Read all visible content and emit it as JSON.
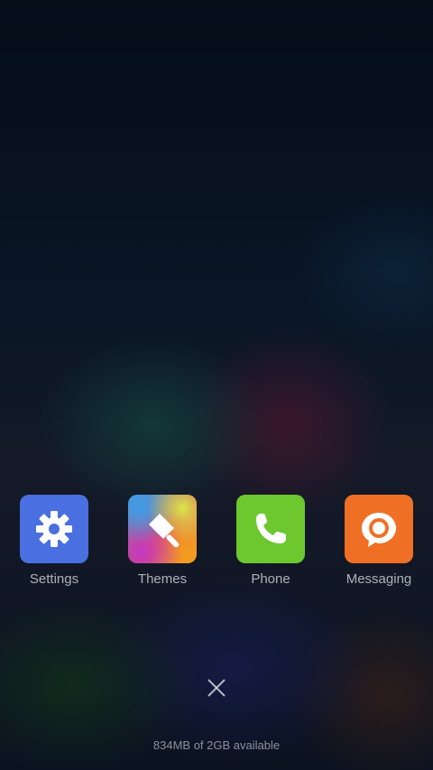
{
  "recent_apps": [
    {
      "label": "Settings",
      "icon": "gear-icon",
      "color": "#4a6fe0"
    },
    {
      "label": "Themes",
      "icon": "paintbrush-icon",
      "color": "#e6502f"
    },
    {
      "label": "Phone",
      "icon": "phone-icon",
      "color": "#6dc72f"
    },
    {
      "label": "Messaging",
      "icon": "chat-bubble-icon",
      "color": "#ef7024"
    }
  ],
  "close_button": {
    "icon": "close-icon"
  },
  "memory_status": "834MB of 2GB available"
}
